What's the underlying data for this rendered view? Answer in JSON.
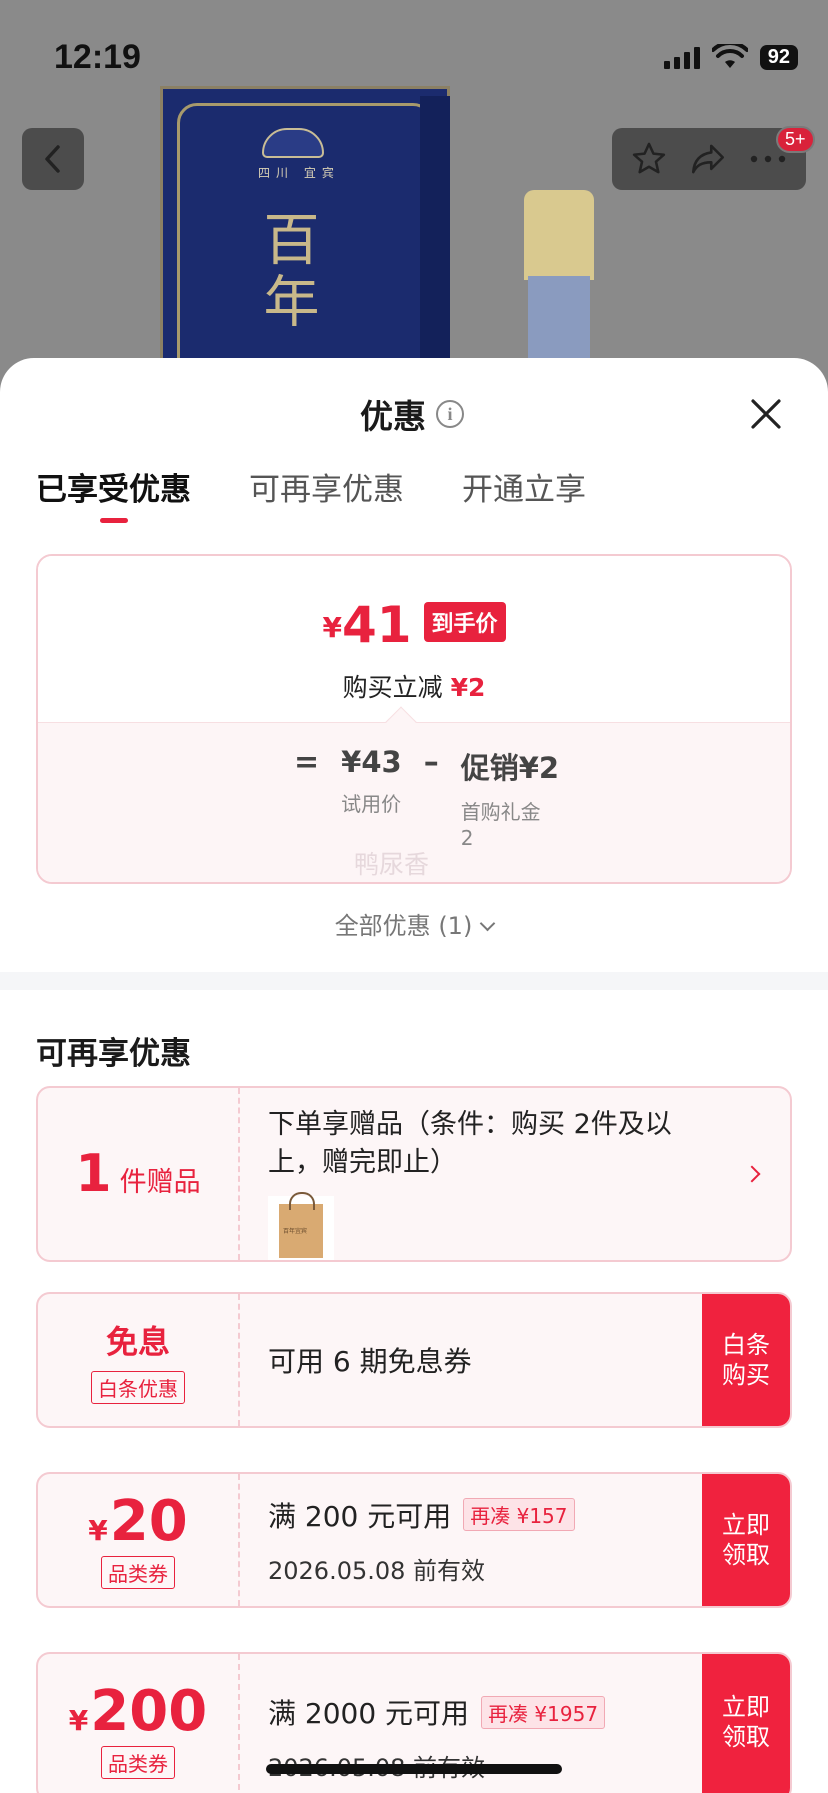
{
  "status_bar": {
    "time": "12:19",
    "battery": "92"
  },
  "nav": {
    "badge": "5+"
  },
  "product": {
    "box_text": "四川 宜宾",
    "title": "百年"
  },
  "sheet": {
    "title": "优惠",
    "tabs": [
      {
        "label": "已享受优惠"
      },
      {
        "label": "可再享优惠"
      },
      {
        "label": "开通立享"
      }
    ]
  },
  "price_card": {
    "yen": "¥",
    "final_price": "41",
    "final_tag": "到手价",
    "instant_label": "购买立减",
    "instant_amount": "¥2",
    "equals": "=",
    "trial_price": "¥43",
    "trial_label": "试用价",
    "minus": "–",
    "promo": "促销¥2",
    "promo_label": "首购礼金\n2",
    "watermark": "鸭尿香"
  },
  "all_offers": "全部优惠 (1)",
  "more_section": {
    "title": "可再享优惠",
    "gift": {
      "count": "1",
      "unit": "件赠品",
      "desc": "下单享赠品（条件：购买 2件及以上，赠完即止）",
      "bag_text": "百年宜宾"
    },
    "interest_free": {
      "title": "免息",
      "tag": "白条优惠",
      "desc": "可用 6 期免息券",
      "button": "白条\n购买"
    },
    "coupons": [
      {
        "yen": "¥",
        "amount": "20",
        "tag": "品类券",
        "condition": "满 200 元可用",
        "badge": "再凑 ¥157",
        "valid": "2026.05.08 前有效",
        "button": "立即\n领取"
      },
      {
        "yen": "¥",
        "amount": "200",
        "tag": "品类券",
        "condition": "满 2000 元可用",
        "badge": "再凑 ¥1957",
        "valid": "2026.05.08 前有效",
        "button": "立即\n领取"
      }
    ]
  },
  "colors": {
    "accent": "#e8223e",
    "button": "#f0223e",
    "card_border": "#f4cad1"
  }
}
